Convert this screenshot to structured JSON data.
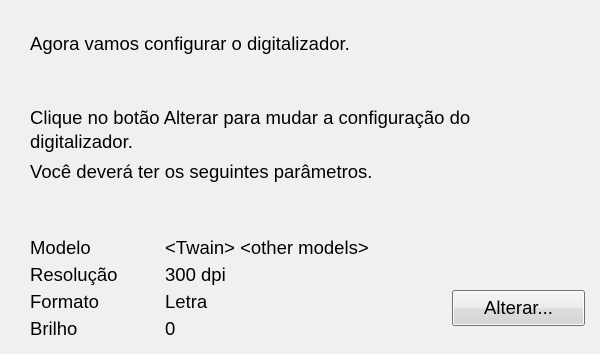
{
  "intro": {
    "line1": "Agora vamos configurar o digitalizador.",
    "line2": "Clique no botão Alterar para mudar a configuração do\ndigitalizador.",
    "line3": "Você deverá ter os seguintes parâmetros."
  },
  "params": [
    {
      "label": "Modelo",
      "value": "<Twain> <other models>"
    },
    {
      "label": "Resolução",
      "value": "300 dpi"
    },
    {
      "label": "Formato",
      "value": "Letra"
    },
    {
      "label": "Brilho",
      "value": "0"
    }
  ],
  "buttons": {
    "change_label": "Alterar..."
  },
  "colors": {
    "background": "#f0f0f0",
    "text": "#000000",
    "button_border": "#707070"
  }
}
